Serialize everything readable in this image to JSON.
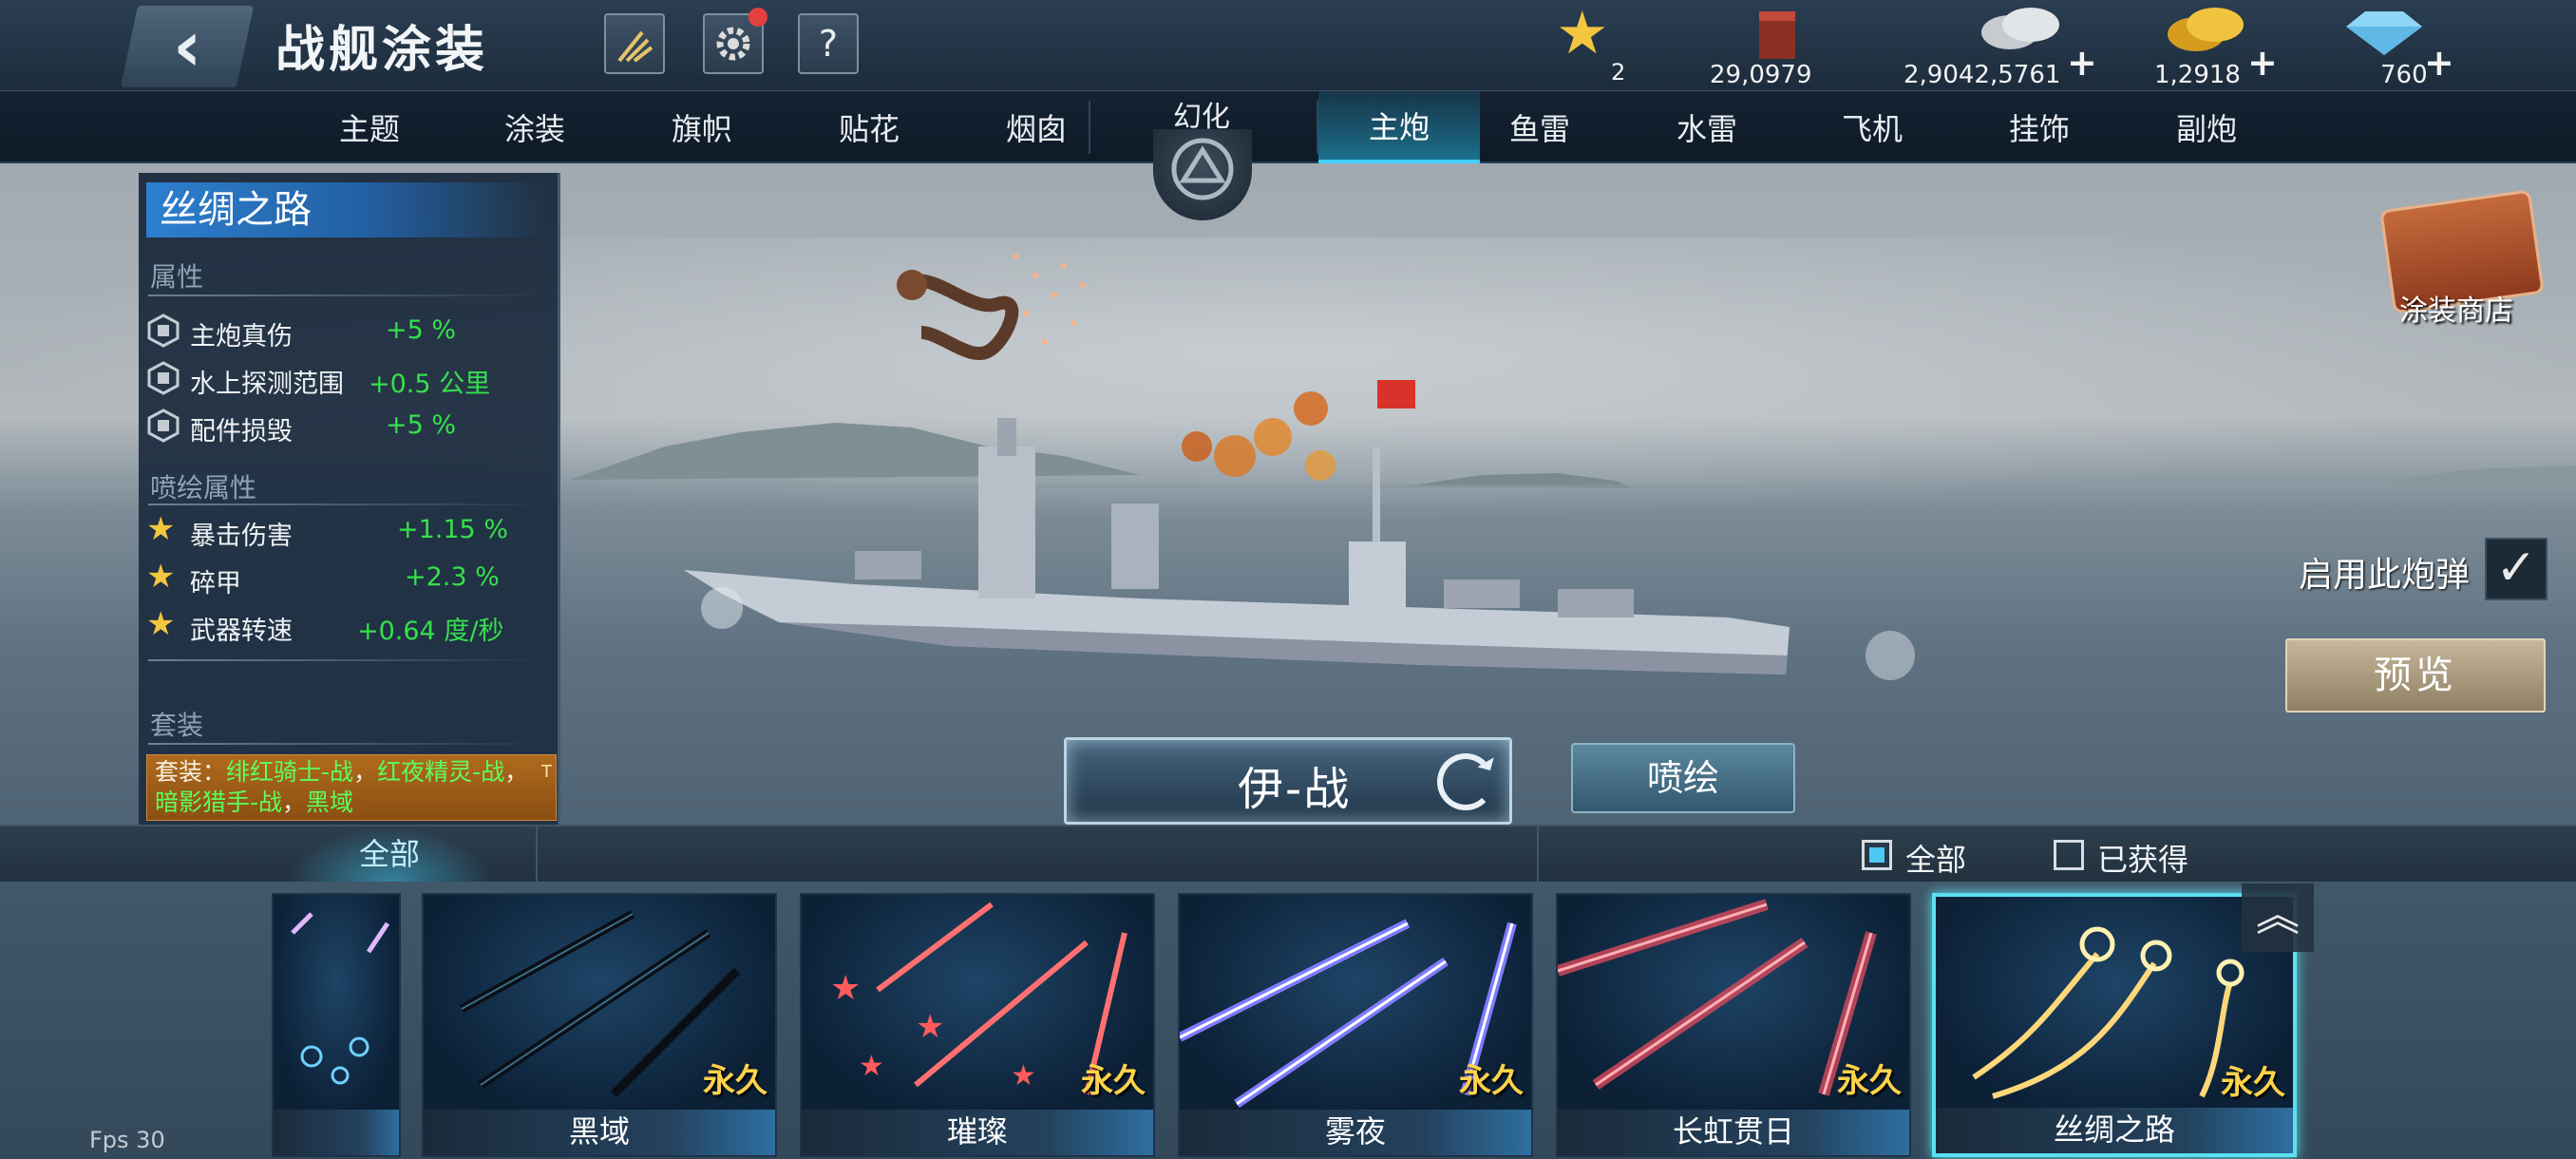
{
  "header": {
    "title": "战舰涂装",
    "back_icon": "‹",
    "help_label": "?",
    "resources": [
      {
        "icon": "star-icon",
        "value": "2"
      },
      {
        "icon": "paint-bucket-icon",
        "value": "29,0979"
      },
      {
        "icon": "silver-coins-icon",
        "value": "2,9042,5761",
        "plus": "+"
      },
      {
        "icon": "gold-coins-icon",
        "value": "1,2918",
        "plus": "+"
      },
      {
        "icon": "diamond-icon",
        "value": "760",
        "plus": "+"
      }
    ]
  },
  "tabs": {
    "left": [
      "主题",
      "涂装",
      "旗帜",
      "贴花",
      "烟囱"
    ],
    "illusion": "幻化",
    "right": [
      "主炮",
      "鱼雷",
      "水雷",
      "飞机",
      "挂饰",
      "副炮"
    ],
    "active": "主炮"
  },
  "panel": {
    "title": "丝绸之路",
    "attr_header": "属性",
    "attributes": [
      {
        "name": "主炮真伤",
        "value": "+5 %"
      },
      {
        "name": "水上探测范围",
        "value": "+0.5 公里"
      },
      {
        "name": "配件损毁",
        "value": "+5 %"
      }
    ],
    "spray_header": "喷绘属性",
    "spray_attributes": [
      {
        "name": "暴击伤害",
        "value": "+1.15 %"
      },
      {
        "name": "碎甲",
        "value": "+2.3 %"
      },
      {
        "name": "武器转速",
        "value": "+0.64 度/秒"
      }
    ],
    "set_header": "套装",
    "set_prefix": "套装：",
    "set_items": [
      "绯红骑士-战",
      "红夜精灵-战",
      "暗影猎手-战",
      "黑域"
    ],
    "set_sep": "，",
    "set_tag": "T"
  },
  "center": {
    "ammo_label": "伊-战",
    "spray_button": "喷绘"
  },
  "right": {
    "shop_label": "涂装商店",
    "enable_label": "启用此炮弹",
    "enable_check": "✓",
    "preview_button": "预览"
  },
  "filter": {
    "all_tab": "全部",
    "check_all": "全部",
    "check_owned": "已获得"
  },
  "cards": [
    {
      "name": "",
      "perm": ""
    },
    {
      "name": "黑域",
      "perm": "永久"
    },
    {
      "name": "璀璨",
      "perm": "永久"
    },
    {
      "name": "雾夜",
      "perm": "永久"
    },
    {
      "name": "长虹贯日",
      "perm": "永久"
    },
    {
      "name": "丝绸之路",
      "perm": "永久"
    }
  ],
  "collapse_icon": "︽",
  "fps": "Fps 30",
  "colors": {
    "accent": "#3fd0ff",
    "attr_value": "#35e04c",
    "set_green": "#5cff5c",
    "perm_gold": "#ffd24a"
  }
}
